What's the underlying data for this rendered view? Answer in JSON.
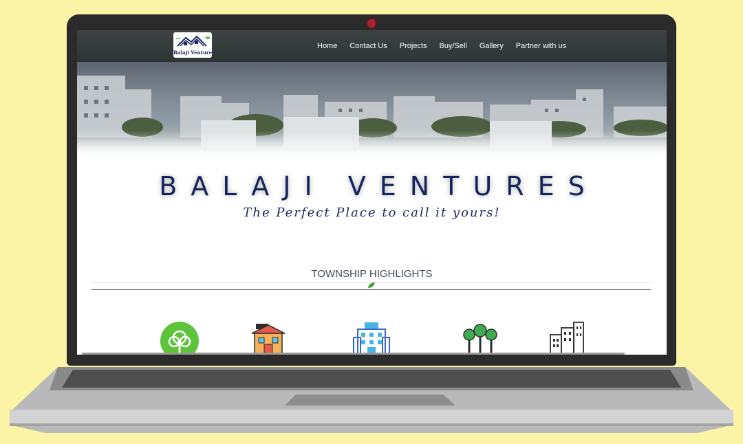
{
  "site": {
    "logo_text": "Balaji Ventures",
    "nav": [
      "Home",
      "Contact Us",
      "Projects",
      "Buy/Sell",
      "Gallery",
      "Partner with us"
    ]
  },
  "hero": {
    "brand": "BALAJI VENTURES",
    "tagline": "The Perfect Place to call it yours!"
  },
  "highlights": {
    "title": "TOWNSHIP HIGHLIGHTS",
    "divider_icon": "leaf-icon",
    "icons": [
      "tree-circle-icon",
      "house-icon",
      "building-blue-icon",
      "trees-icon",
      "buildings-outline-icon"
    ]
  },
  "colors": {
    "brand": "#15245c",
    "navbar": "#3a3f40",
    "accent_green": "#5cc33a",
    "background": "#fbf3a6"
  }
}
